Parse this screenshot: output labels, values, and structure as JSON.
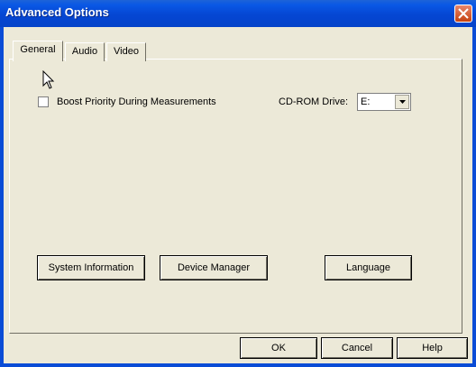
{
  "window": {
    "title": "Advanced Options"
  },
  "tabs": [
    {
      "label": "General",
      "active": true
    },
    {
      "label": "Audio",
      "active": false
    },
    {
      "label": "Video",
      "active": false
    }
  ],
  "general": {
    "boost_priority_label": "Boost Priority During Measurements",
    "boost_priority_checked": false,
    "cdrom_label": "CD-ROM Drive:",
    "cdrom_value": "E:"
  },
  "buttons": {
    "system_information": "System Information",
    "device_manager": "Device Manager",
    "language": "Language"
  },
  "footer": {
    "ok": "OK",
    "cancel": "Cancel",
    "help": "Help"
  },
  "icons": {
    "close": "close-icon",
    "dropdown": "chevron-down-icon",
    "cursor": "mouse-pointer-icon"
  },
  "colors": {
    "titlebar": "#0a58e5",
    "dialog_bg": "#ece9d8",
    "close": "#c5410f"
  }
}
